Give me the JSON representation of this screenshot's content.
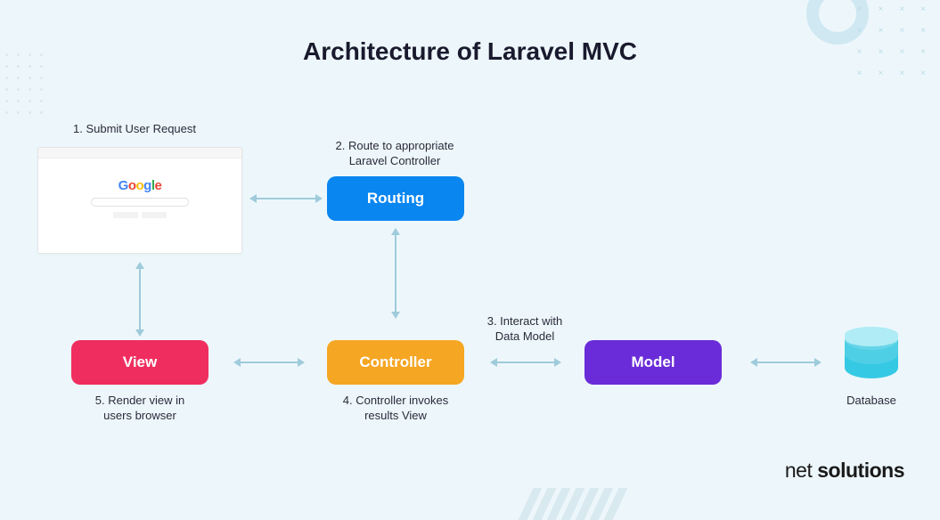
{
  "title": "Architecture of Laravel MVC",
  "captions": {
    "step1": "1. Submit User Request",
    "step2a": "2. Route to appropriate",
    "step2b": "Laravel Controller",
    "step3a": "3. Interact with",
    "step3b": "Data Model",
    "step4a": "4. Controller invokes",
    "step4b": "results View",
    "step5a": "5. Render view in",
    "step5b": "users browser"
  },
  "boxes": {
    "routing": "Routing",
    "controller": "Controller",
    "view": "View",
    "model": "Model"
  },
  "db_label": "Database",
  "brand_light": "net ",
  "brand_bold": "solutions",
  "colors": {
    "routing": "#0a86f0",
    "controller": "#f5a623",
    "view": "#ef2e5f",
    "model": "#6a2cd8",
    "db1": "#66d5e8",
    "db2": "#4fcfe6",
    "db3": "#35c9e4",
    "arrow": "#9fcbdb"
  }
}
